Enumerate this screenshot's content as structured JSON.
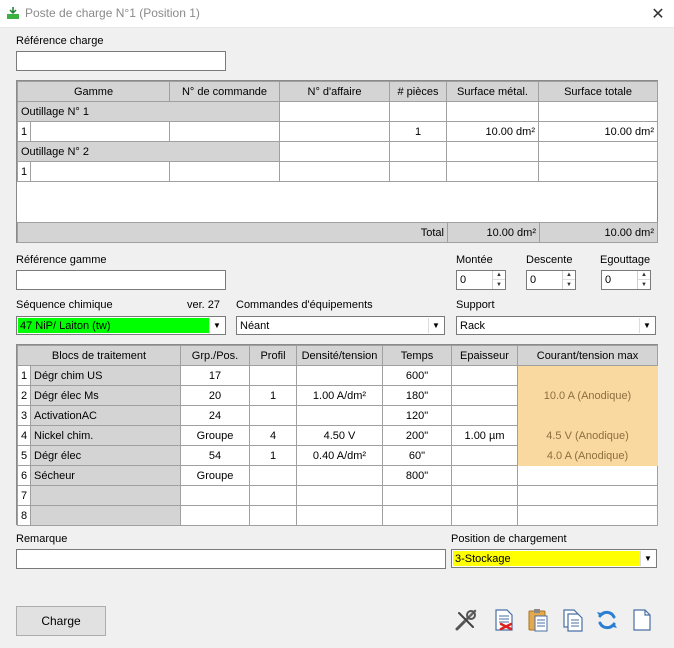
{
  "window": {
    "title": "Poste de charge N°1 (Position 1)",
    "close_glyph": "✕"
  },
  "reference_charge": {
    "label": "Référence charge",
    "value": ""
  },
  "order_table": {
    "columns": [
      "Gamme",
      "N° de commande",
      "N° d'affaire",
      "# pièces",
      "Surface métal.",
      "Surface totale"
    ],
    "groups": [
      {
        "name": "Outillage N° 1",
        "rows": [
          {
            "idx": "1",
            "gamme": "",
            "commande": "",
            "affaire": "",
            "pieces": "1",
            "surf_metal": "10.00 dm²",
            "surf_totale": "10.00 dm²"
          }
        ]
      },
      {
        "name": "Outillage N° 2",
        "rows": [
          {
            "idx": "1",
            "gamme": "",
            "commande": "",
            "affaire": "",
            "pieces": "",
            "surf_metal": "",
            "surf_totale": ""
          }
        ]
      }
    ],
    "total": {
      "label": "Total",
      "surf_metal": "10.00 dm²",
      "surf_totale": "10.00 dm²"
    }
  },
  "reference_gamme": {
    "label": "Référence gamme",
    "value": ""
  },
  "montee": {
    "label": "Montée",
    "value": "0"
  },
  "descente": {
    "label": "Descente",
    "value": "0"
  },
  "egouttage": {
    "label": "Egouttage",
    "value": "0"
  },
  "sequence": {
    "label": "Séquence chimique",
    "version": "ver. 27",
    "value": "47 NiP/ Laiton (tw)",
    "color": "#00ff00"
  },
  "commandes": {
    "label": "Commandes d'équipements",
    "value": "Néant"
  },
  "support": {
    "label": "Support",
    "value": "Rack"
  },
  "blocs_table": {
    "columns": [
      "Blocs de traitement",
      "Grp./Pos.",
      "Profil",
      "Densité/tension",
      "Temps",
      "Epaisseur",
      "Courant/tension max"
    ],
    "rows": [
      {
        "idx": "1",
        "bloc": "Dégr chim US",
        "grp": "17",
        "profil": "",
        "densite": "",
        "temps": "600\"",
        "epaisseur": "",
        "courant": ""
      },
      {
        "idx": "2",
        "bloc": "Dégr élec Ms",
        "grp": "20",
        "profil": "1",
        "densite": "1.00 A/dm²",
        "temps": "180\"",
        "epaisseur": "",
        "courant": "10.0 A (Anodique)"
      },
      {
        "idx": "3",
        "bloc": "ActivationAC",
        "grp": "24",
        "profil": "",
        "densite": "",
        "temps": "120\"",
        "epaisseur": "",
        "courant": ""
      },
      {
        "idx": "4",
        "bloc": "Nickel chim.",
        "grp": "Groupe",
        "profil": "4",
        "densite": "4.50 V",
        "temps": "200\"",
        "epaisseur": "1.00 µm",
        "courant": "4.5 V (Anodique)"
      },
      {
        "idx": "5",
        "bloc": "Dégr élec",
        "grp": "54",
        "profil": "1",
        "densite": "0.40 A/dm²",
        "temps": "60\"",
        "epaisseur": "",
        "courant": "4.0 A (Anodique)"
      },
      {
        "idx": "6",
        "bloc": "Sécheur",
        "grp": "Groupe",
        "profil": "",
        "densite": "",
        "temps": "800\"",
        "epaisseur": "",
        "courant": ""
      },
      {
        "idx": "7",
        "bloc": "",
        "grp": "",
        "profil": "",
        "densite": "",
        "temps": "",
        "epaisseur": "",
        "courant": ""
      },
      {
        "idx": "8",
        "bloc": "",
        "grp": "",
        "profil": "",
        "densite": "",
        "temps": "",
        "epaisseur": "",
        "courant": ""
      }
    ],
    "highlight_color": "#fad9a0"
  },
  "remarque": {
    "label": "Remarque",
    "value": ""
  },
  "position_chargement": {
    "label": "Position de chargement",
    "value": "3-Stockage",
    "color": "#ffff00"
  },
  "charge_button": {
    "label": "Charge"
  },
  "toolbar_icons": [
    "tools-icon",
    "document-delete-icon",
    "clipboard-paste-icon",
    "copy-icon",
    "refresh-icon",
    "new-document-icon"
  ]
}
